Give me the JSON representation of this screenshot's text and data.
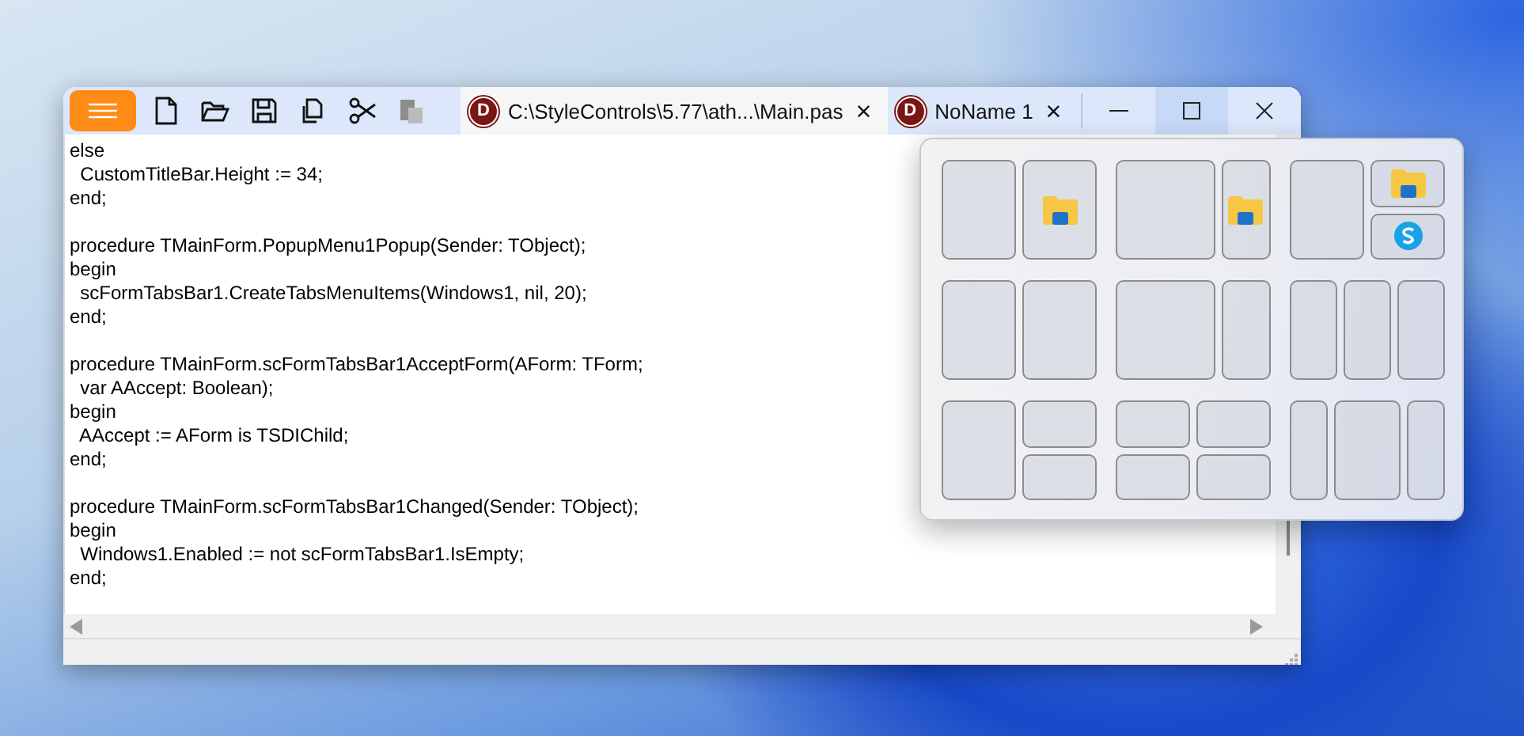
{
  "toolbar": [
    {
      "kind": "new",
      "disabled": false
    },
    {
      "kind": "open",
      "disabled": false
    },
    {
      "kind": "save",
      "disabled": false
    },
    {
      "kind": "copy",
      "disabled": false
    },
    {
      "kind": "cut",
      "disabled": false
    },
    {
      "kind": "paste",
      "disabled": true
    }
  ],
  "tabs": [
    {
      "logo": "D",
      "label": "C:\\StyleControls\\5.77\\ath...\\Main.pas",
      "close": "×",
      "selected": true
    },
    {
      "logo": "D",
      "label": "NoName 1",
      "close": "×",
      "selected": false
    }
  ],
  "window_controls": [
    {
      "kind": "minimize",
      "hovered": false
    },
    {
      "kind": "maximize",
      "hovered": true
    },
    {
      "kind": "close",
      "hovered": false
    }
  ],
  "editor": {
    "blocks": [
      {
        "lines": [
          "else",
          "  CustomTitleBar.Height := 34;",
          "end;"
        ]
      },
      {
        "lines": [
          "procedure TMainForm.PopupMenu1Popup(Sender: TObject);",
          "begin",
          "  scFormTabsBar1.CreateTabsMenuItems(Windows1, nil, 20);",
          "end;"
        ]
      },
      {
        "lines": [
          "procedure TMainForm.scFormTabsBar1AcceptForm(AForm: TForm;",
          "  var AAccept: Boolean);",
          "begin",
          "  AAccept := AForm is TSDIChild;",
          "end;"
        ]
      },
      {
        "lines": [
          "procedure TMainForm.scFormTabsBar1Changed(Sender: TObject);",
          "begin",
          "  Windows1.Enabled := not scFormTabsBar1.IsEmpty;",
          "end;"
        ]
      }
    ]
  },
  "snap_layouts": [
    {
      "kind": "halves",
      "zones": [
        {
          "kind": "empty"
        },
        {
          "kind": "folder"
        }
      ]
    },
    {
      "kind": "wide-narrow",
      "zones": [
        {
          "kind": "empty"
        },
        {
          "kind": "folder"
        }
      ]
    },
    {
      "kind": "main-stack",
      "zones": [
        {
          "kind": "empty"
        },
        {
          "kind": "folder"
        },
        {
          "kind": "s-app"
        }
      ]
    },
    {
      "kind": "halves",
      "zones": [
        {
          "kind": "empty"
        },
        {
          "kind": "empty"
        }
      ]
    },
    {
      "kind": "wide-narrow",
      "zones": [
        {
          "kind": "empty"
        },
        {
          "kind": "empty"
        }
      ]
    },
    {
      "kind": "thirds",
      "zones": [
        {
          "kind": "empty"
        },
        {
          "kind": "empty"
        },
        {
          "kind": "empty"
        }
      ]
    },
    {
      "kind": "main-stack",
      "zones": [
        {
          "kind": "empty"
        },
        {
          "kind": "empty"
        },
        {
          "kind": "empty"
        }
      ]
    },
    {
      "kind": "quarters",
      "zones": [
        {
          "kind": "empty"
        },
        {
          "kind": "empty"
        },
        {
          "kind": "empty"
        },
        {
          "kind": "empty"
        }
      ]
    },
    {
      "kind": "narrow-wide-narrow",
      "zones": [
        {
          "kind": "empty"
        },
        {
          "kind": "empty"
        },
        {
          "kind": "empty"
        }
      ]
    }
  ]
}
